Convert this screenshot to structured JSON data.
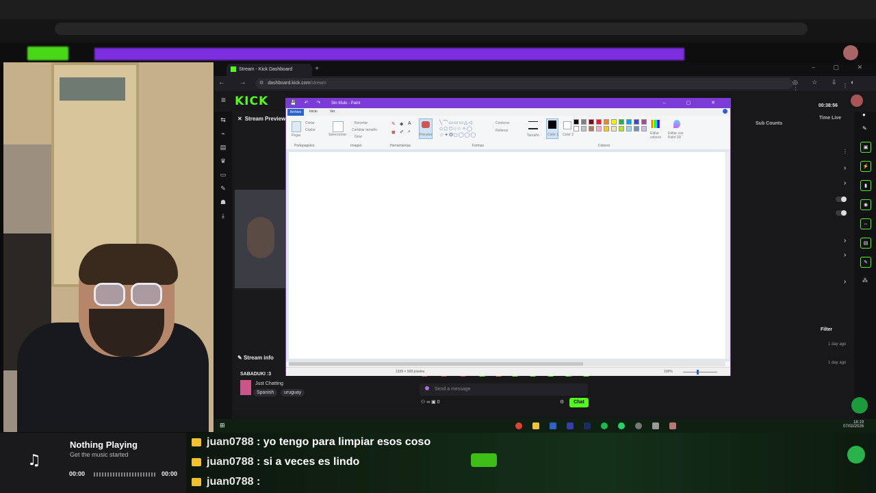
{
  "browser": {
    "tab_title": "Stream - Kick Dashboard",
    "new_tab": "+",
    "window_controls": "– ▢ ✕",
    "nav_icons": "← → ⟳",
    "url_host": "dashboard.kick.com",
    "url_path": "/stream",
    "toolbar_icons": "◎ ☆ ⇩ ◐ ⋮"
  },
  "dashboard": {
    "logo": "KICK",
    "menu_icon": "≡",
    "stream_preview_label": "Stream Preview",
    "stream_info_label": "Stream info",
    "stream_title": "SABADUKI :3",
    "category": "Just Chatting",
    "tags": [
      "Spanish",
      "uruguay"
    ],
    "time_live_value": "00:38:56",
    "sub_counts_label": "Sub Counts",
    "time_live_label": "Time Live",
    "filter_label": "Filter",
    "ago_1": "1 day ago",
    "ago_2": "1 day ago",
    "chat_placeholder": "Send a message",
    "chat_button": "Chat",
    "chat_counts": "⚇ ∞   ▣ 0",
    "sidebar_icons": [
      "⇆",
      "⌁",
      "▤",
      "♛",
      "▭",
      "✎",
      "☗",
      "⤓"
    ]
  },
  "paint": {
    "title": "Sin título - Paint",
    "quick_access": "💾 ↶ ↷",
    "window_controls": "– ▢ ✕",
    "tabs": {
      "archivo": "Archivo",
      "inicio": "Inicio",
      "ver": "Ver"
    },
    "groups": {
      "portapapeles": "Portapapeles",
      "imagen": "Imagen",
      "herramientas": "Herramientas",
      "formas": "Formas",
      "colores": "Colores"
    },
    "buttons": {
      "pegar": "Pegar",
      "cortar": "Cortar",
      "copiar": "Copiar",
      "seleccionar": "Seleccionar",
      "recortar": "Recortar",
      "cambiar_tamano": "Cambiar tamaño",
      "girar": "Girar",
      "pinceles": "Pinceles",
      "contorno": "Contorno",
      "relleno": "Rellenar",
      "tamano": "Tamaño",
      "color1": "Color 1",
      "color2": "Color 2",
      "editar_colores": "Editar colores",
      "editar_paint3d": "Editar con Paint 3D"
    },
    "palette_row1": [
      "#000000",
      "#7f7f7f",
      "#880015",
      "#ed1c24",
      "#ff7f27",
      "#fff200",
      "#22b14c",
      "#00a2e8",
      "#3f48cc",
      "#a349a4"
    ],
    "palette_row2": [
      "#ffffff",
      "#c3c3c3",
      "#b97a57",
      "#ffaec9",
      "#ffc90e",
      "#efe4b0",
      "#b5e61d",
      "#99d9ea",
      "#7092be",
      "#c8bfe7"
    ],
    "status_dims": "1339 × 928 píxeles",
    "zoom": "100%"
  },
  "overlay": {
    "music_icon": "♫",
    "music_title": "Nothing Playing",
    "music_subtitle": "Get the music started",
    "time_start": "00:00",
    "time_end": "00:00",
    "chat_lines": [
      {
        "user": "juan0788",
        "message": ": yo tengo para limpiar esos coso"
      },
      {
        "user": "juan0788",
        "message": ": si a veces es lindo"
      },
      {
        "user": "juan0788",
        "message": ":"
      }
    ],
    "clock_time": "18:19",
    "clock_date": "07/02/2026"
  }
}
